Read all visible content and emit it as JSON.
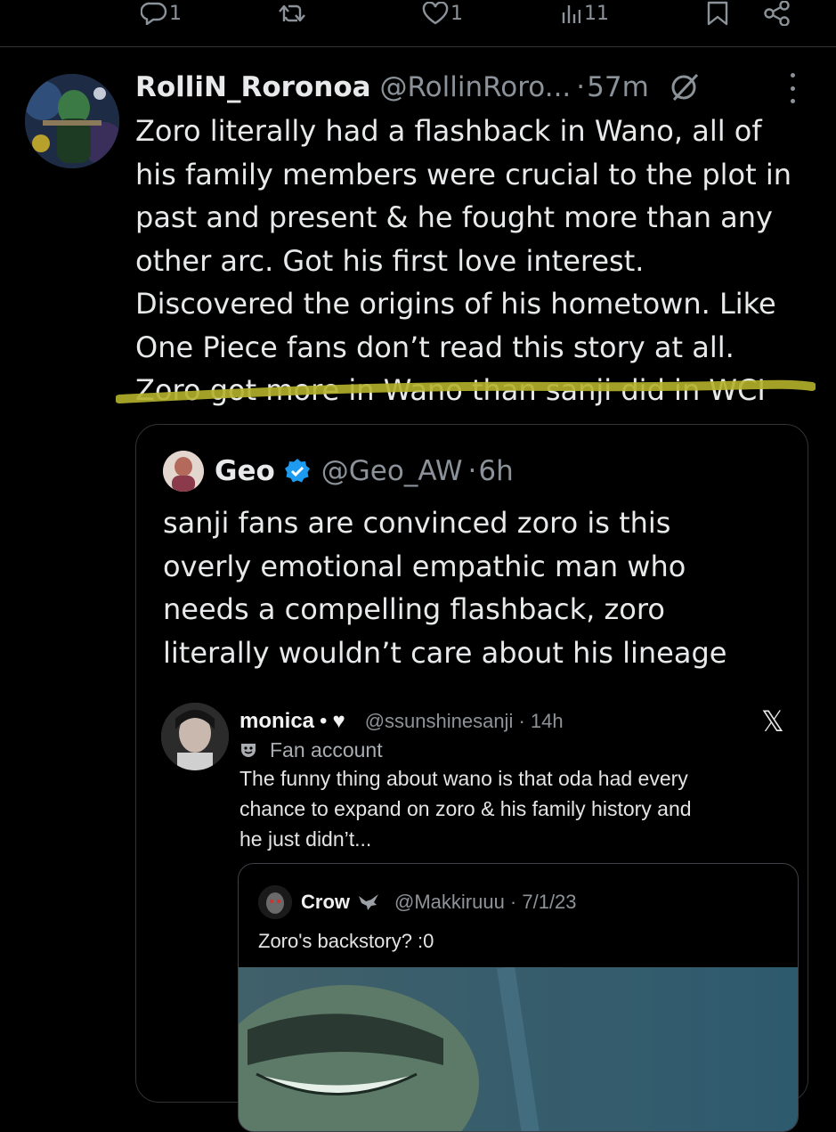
{
  "action_bar": {
    "reply_count": "1",
    "like_count": "1",
    "view_count": "11"
  },
  "tweet": {
    "display_name": "RolliN_Roronoa",
    "handle": "@RollinRoro...",
    "separator": "·",
    "time": "57m",
    "lines": [
      "Zoro literally had a flashback in Wano, all of",
      "his family members were crucial to the plot in",
      "past and present & he fought more than any",
      "other arc. Got his first love interest.",
      "Discovered the origins of his hometown. Like",
      "One Piece fans don’t read this story at all.",
      "Zoro got more in Wano than sanji did in WCI"
    ],
    "highlight_color": "#b5b12c"
  },
  "quote": {
    "display_name": "Geo",
    "handle": "@Geo_AW",
    "separator": "·",
    "time": "6h",
    "verified_color": "#1d9bf0",
    "lines": [
      "sanji fans are convinced zoro is this",
      "overly emotional empathic man who",
      "needs a compelling flashback, zoro",
      "literally wouldn’t care about his lineage"
    ]
  },
  "screenshot": {
    "display_name": "monica",
    "name_separator": "•",
    "heart": "♥",
    "handle_time": "@ssunshinesanji · 14h",
    "platform_logo": "𝕏",
    "fan_label": "Fan account",
    "lines": [
      "The funny thing about wano is that oda had every",
      "chance to expand on zoro & his family history and",
      "he just didn’t..."
    ],
    "inner_post": {
      "display_name": "Crow",
      "handle_time": "@Makkiruuu · 7/1/23",
      "text": "Zoro's backstory? :0"
    }
  }
}
